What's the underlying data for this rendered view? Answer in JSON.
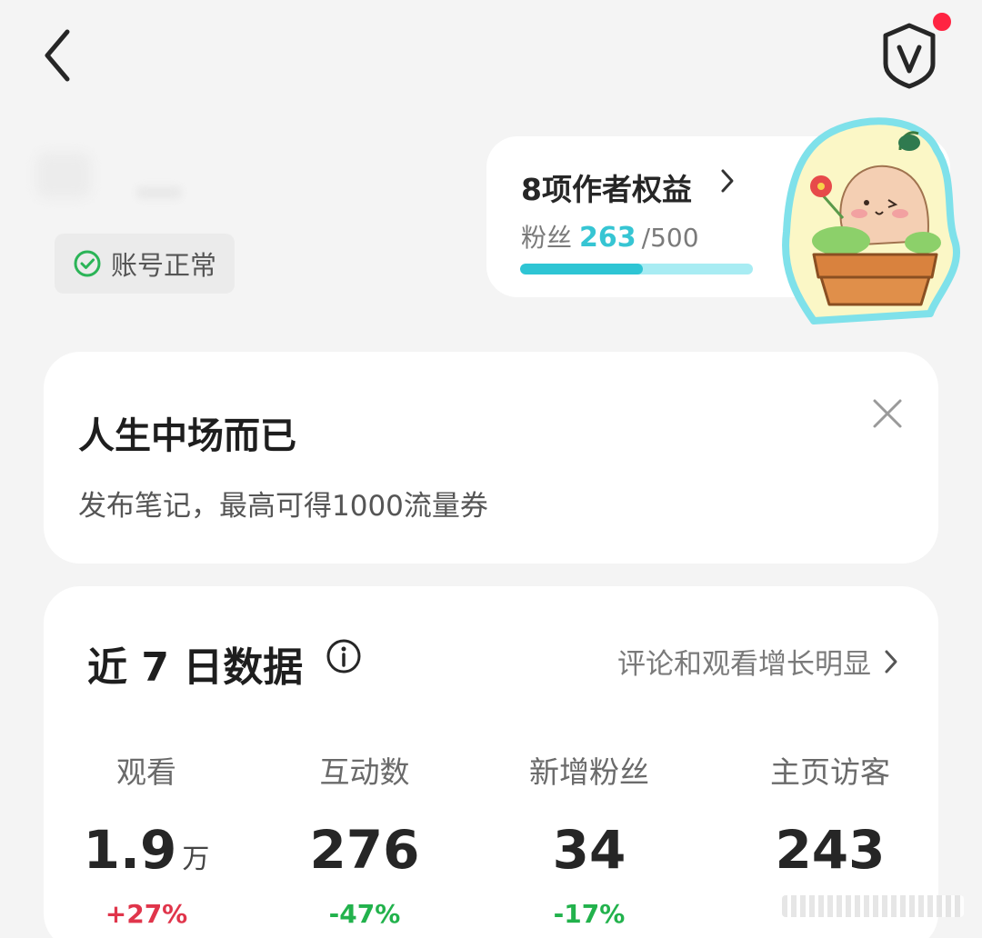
{
  "header": {
    "back_icon": "chevron-left-icon",
    "shield_icon": "shield-v-icon",
    "notification_dot_color": "#ff2442"
  },
  "account": {
    "status_label": "账号正常"
  },
  "rights": {
    "title": "8项作者权益",
    "fans_label": "粉丝",
    "fans_count": "263",
    "fans_goal": "/500",
    "progress": 0.526,
    "accent_color": "#36c5d3"
  },
  "promo": {
    "title": "人生中场而已",
    "subtitle": "发布笔记，最高可得1000流量券"
  },
  "stats": {
    "title": "近 7 日数据",
    "trend_link": "评论和观看增长明显",
    "metrics": [
      {
        "label": "观看",
        "value": "1.9",
        "unit": "万",
        "change": "+27%"
      },
      {
        "label": "互动数",
        "value": "276",
        "unit": "",
        "change": "-47%"
      },
      {
        "label": "新增粉丝",
        "value": "34",
        "unit": "",
        "change": "-17%"
      },
      {
        "label": "主页访客",
        "value": "243",
        "unit": "",
        "change": ""
      }
    ],
    "up_color": "#e0354b",
    "down_color": "#22b24c"
  }
}
